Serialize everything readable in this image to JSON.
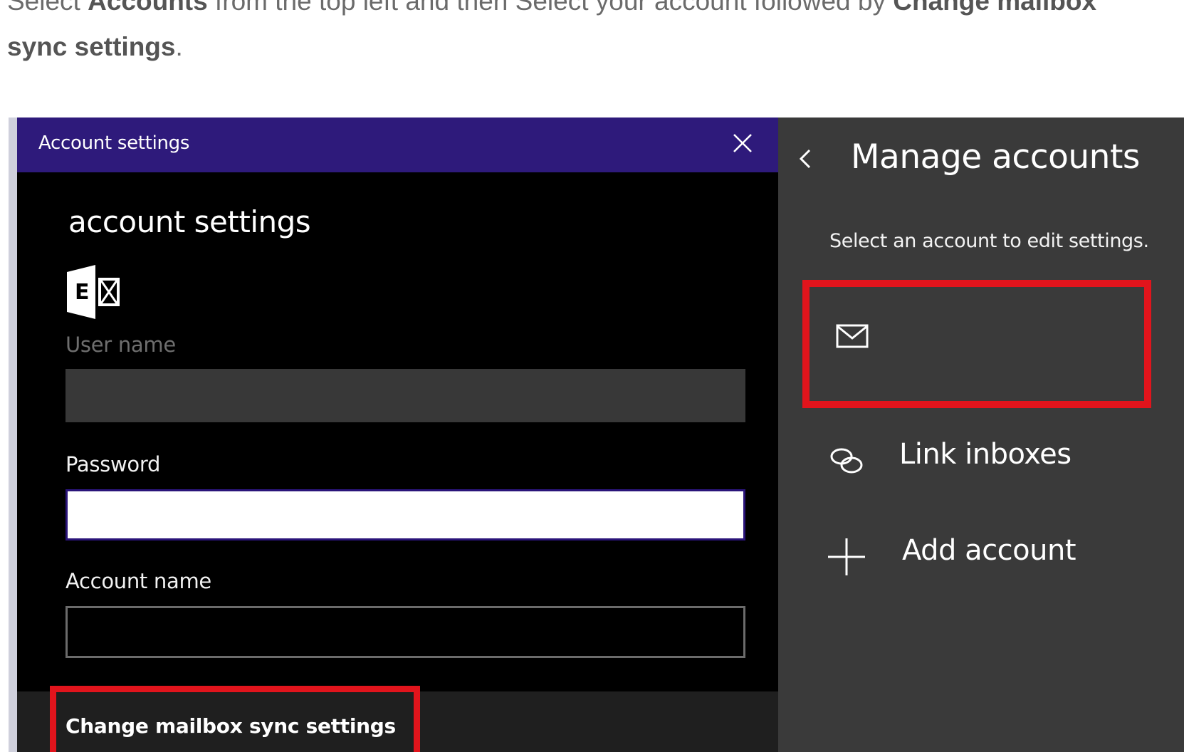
{
  "instruction": {
    "line1_pre": "Select ",
    "line1_bold": "Accounts",
    "line1_mid": " from the top left and then Select your account followed by ",
    "line1_bold2": "Change mailbox",
    "line2_bold": "sync settings",
    "line2_post": "."
  },
  "dialog": {
    "window_title": "Account settings",
    "heading": "account settings",
    "username_label": "User name",
    "username_value": "",
    "password_label": "Password",
    "password_value": "",
    "accountname_label": "Account name",
    "accountname_value": "",
    "sync_link": "Change mailbox sync settings"
  },
  "pane": {
    "title": "Manage accounts",
    "subtitle": "Select an account to edit settings.",
    "items": [
      {
        "label": "Link inboxes",
        "icon": "link-icon"
      },
      {
        "label": "Add account",
        "icon": "plus-icon"
      }
    ]
  },
  "colors": {
    "titlebar": "#2e1a7b",
    "highlight": "#e1141c",
    "pane_bg": "#3a3a3a",
    "dialog_bg": "#000000"
  }
}
